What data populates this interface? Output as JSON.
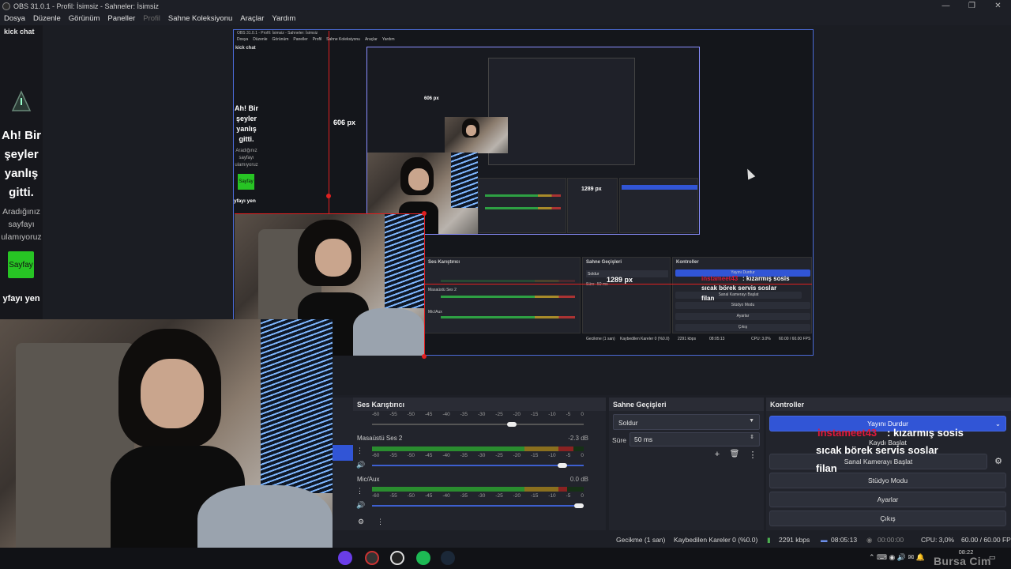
{
  "titlebar": {
    "text": "OBS 31.0.1 - Profil: İsimsiz - Sahneler: İsimsiz"
  },
  "window_controls": {
    "minimize": "—",
    "maximize": "❐",
    "close": "✕"
  },
  "menu": {
    "items": [
      "Dosya",
      "Düzenle",
      "Görünüm",
      "Paneller",
      "Profil",
      "Sahne Koleksiyonu",
      "Araçlar",
      "Yardım"
    ]
  },
  "left_dock": {
    "title": "kick chat",
    "error_title": "Ah! Bir şeyler yanlış gitti.",
    "error_text": "Aradığınız sayfayı ulamıyoruz",
    "button": "Sayfay",
    "link": "yfayı yen"
  },
  "preview": {
    "dim_label_vertical": "606 px",
    "dim_label_horizontal": "1289 px",
    "nested_dim_vertical": "606 px",
    "nested_title": "OBS 31.0.1 - Profil: İsimsiz - Sahneler: İsimsiz",
    "nested_menu": [
      "Dosya",
      "Düzenle",
      "Görünüm",
      "Paneller",
      "Profil",
      "Sahne Koleksiyonu",
      "Araçlar",
      "Yardım"
    ],
    "nested_dock_title": "kick chat",
    "nested_err_title": "Ah! Bir şeyler yanlış gitti.",
    "nested_err_text": "Aradığınız sayfayı ulamıyoruz",
    "nested_err_button": "Sayfay",
    "nested_err_link": "yfayı yen",
    "nested_panels": {
      "mixer": "Ses Karıştırıcı",
      "transitions": "Sahne Geçişleri",
      "controls": "Kontroller",
      "desktop": "Masaüstü Ses 2",
      "mic": "Mic/Aux",
      "fade": "Soldur",
      "duration": "Süre",
      "duration_value": "50 ms",
      "stop_stream": "Yayını Durdur",
      "virtual_cam": "Sanal Kamerayı Başlat",
      "studio": "Stüdyo Modu",
      "settings": "Ayarlar",
      "exit": "Çıkış",
      "status_delay": "Gecikme (1 san)",
      "status_dropped": "Kaybedilen Kareler 0 (%0.0)",
      "status_kbps": "2291 kbps",
      "status_time": "08:05:13",
      "status_cpu": "CPU: 3.0%",
      "status_fps": "60.00 / 60.00 FPS"
    },
    "nested_overlay_name": "instameet43",
    "nested_overlay_line1": ": kızarmış sosis",
    "nested_overlay_line2": "sıcak börek servis soslar",
    "nested_overlay_line3": "filan"
  },
  "mixer": {
    "title": "Ses Karıştırıcı",
    "scale": [
      "-60",
      "-55",
      "-50",
      "-45",
      "-40",
      "-35",
      "-30",
      "-25",
      "-20",
      "-15",
      "-10",
      "-5",
      "0"
    ],
    "channels": [
      {
        "name": "Masaüstü Ses 2",
        "db": "-2.3 dB",
        "level": 0.95,
        "fader": 0.92
      },
      {
        "name": "Mic/Aux",
        "db": "0.0 dB",
        "level": 0.92,
        "fader": 1.0
      }
    ],
    "first_fader": 0.66
  },
  "transitions": {
    "title": "Sahne Geçişleri",
    "selected": "Soldur",
    "duration_label": "Süre",
    "duration_value": "50 ms"
  },
  "controls": {
    "title": "Kontroller",
    "stop_stream": "Yayını Durdur",
    "start_recording": "Kaydı Başlat",
    "virtual_camera": "Sanal Kamerayı Başlat",
    "studio_mode": "Stüdyo Modu",
    "settings": "Ayarlar",
    "exit": "Çıkış"
  },
  "chat_overlay": {
    "username": "instameet43",
    "line1": ": kızarmış sosis",
    "line2": "sıcak börek servis soslar",
    "line3": "filan"
  },
  "statusbar": {
    "delay": "Gecikme (1 san)",
    "dropped": "Kaybedilen Kareler 0 (%0.0)",
    "bitrate": "2291 kbps",
    "stream_time": "08:05:13",
    "record_time": "00:00:00",
    "cpu": "CPU: 3,0%",
    "fps": "60.00 / 60.00 FPS"
  },
  "taskbar": {
    "clock": "08:22",
    "watermark": "Bursa Cim"
  },
  "colors": {
    "accent": "#3155d6",
    "selection": "#e02020",
    "chat_username": "#e0193a",
    "error_button": "#27c424"
  }
}
